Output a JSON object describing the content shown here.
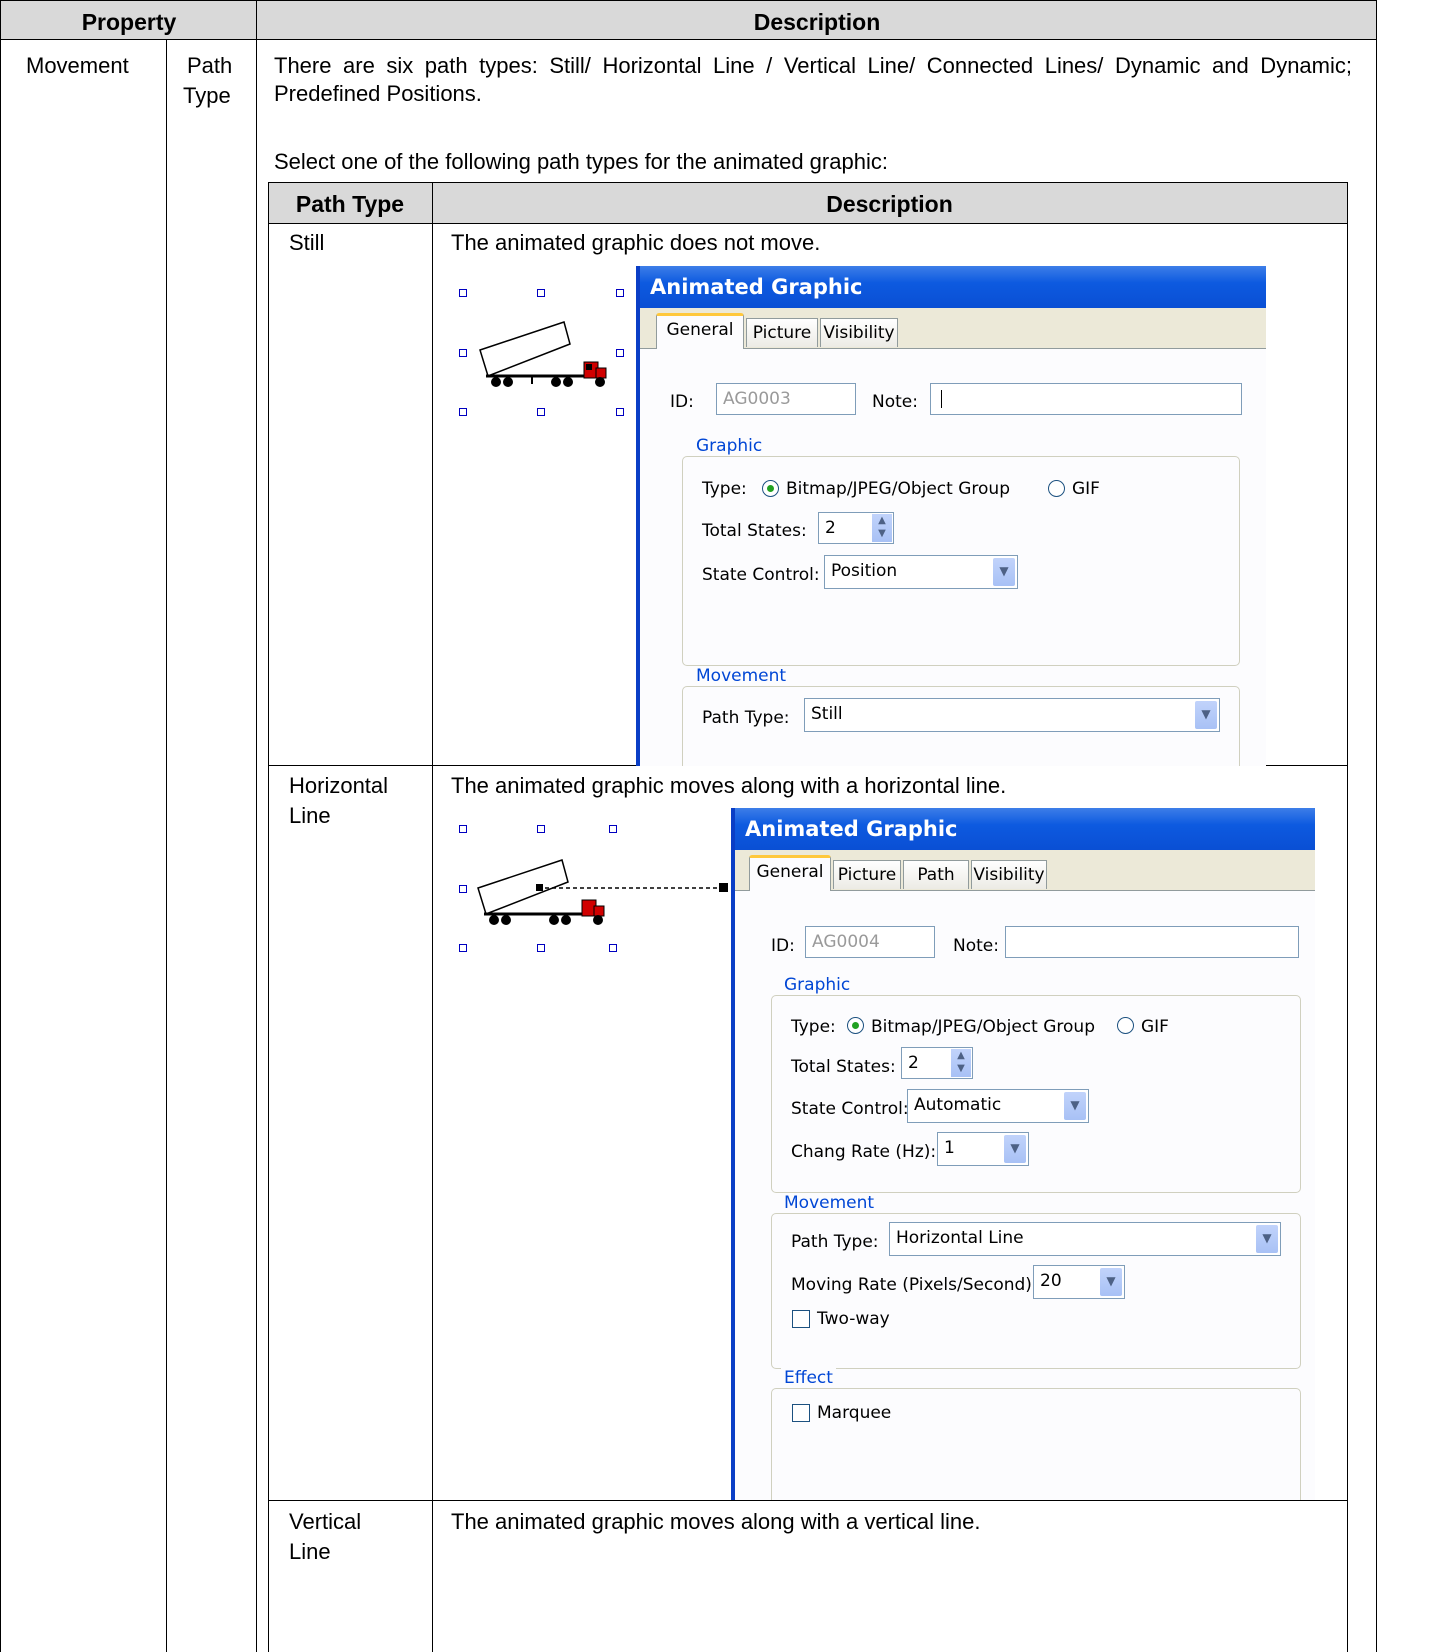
{
  "header": {
    "property": "Property",
    "description": "Description"
  },
  "row": {
    "property": "Movement",
    "sub_line1": "Path",
    "sub_line2": "Type",
    "intro": "There are six path types: Still/ Horizontal Line / Vertical Line/ Connected Lines/ Dynamic and Dynamic; Predefined Positions.",
    "select_text": "Select one of the following path types for the animated graphic:"
  },
  "inner_header": {
    "path_type": "Path Type",
    "description": "Description"
  },
  "rows": [
    {
      "name": "Still",
      "desc": "The animated graphic does not move."
    },
    {
      "name_line1": "Horizontal",
      "name_line2": "Line",
      "desc": "The animated graphic moves along with a horizontal line."
    },
    {
      "name_line1": "Vertical",
      "name_line2": "Line",
      "desc": "The animated graphic moves along with a vertical line."
    }
  ],
  "dialog1": {
    "title": "Animated Graphic",
    "tabs": [
      "General",
      "Picture",
      "Visibility"
    ],
    "id_label": "ID:",
    "id_value": "AG0003",
    "note_label": "Note:",
    "graphic_group": "Graphic",
    "type_label": "Type:",
    "type_opt1": "Bitmap/JPEG/Object Group",
    "type_opt2": "GIF",
    "total_states_label": "Total States:",
    "total_states": "2",
    "state_control_label": "State Control:",
    "state_control": "Position",
    "movement_group": "Movement",
    "path_type_label": "Path Type:",
    "path_type": "Still"
  },
  "dialog2": {
    "title": "Animated Graphic",
    "tabs": [
      "General",
      "Picture",
      "Path",
      "Visibility"
    ],
    "id_label": "ID:",
    "id_value": "AG0004",
    "note_label": "Note:",
    "graphic_group": "Graphic",
    "type_label": "Type:",
    "type_opt1": "Bitmap/JPEG/Object Group",
    "type_opt2": "GIF",
    "total_states_label": "Total States:",
    "total_states": "2",
    "state_control_label": "State Control:",
    "state_control": "Automatic",
    "change_rate_label": "Chang Rate (Hz):",
    "change_rate": "1",
    "movement_group": "Movement",
    "path_type_label": "Path Type:",
    "path_type": "Horizontal Line",
    "moving_rate_label": "Moving Rate (Pixels/Second):",
    "moving_rate": "20",
    "two_way_label": "Two-way",
    "effect_group": "Effect",
    "marquee_label": "Marquee"
  },
  "icons": {
    "truck": "dump-truck-icon",
    "dropdown": "chevron-down-icon",
    "spinner": "spinner-arrows-icon"
  }
}
